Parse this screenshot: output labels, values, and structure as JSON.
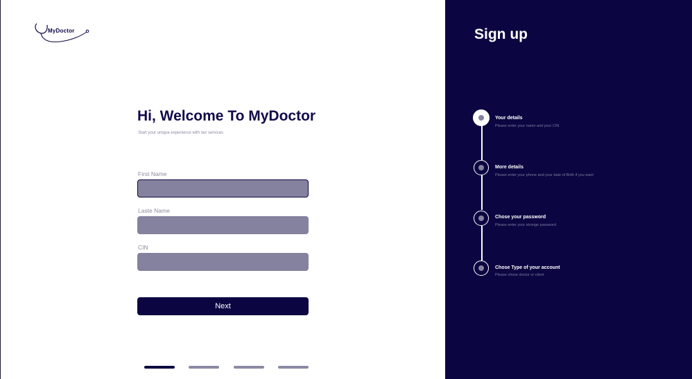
{
  "brand": {
    "name": "MyDoctor"
  },
  "form": {
    "title": "Hi, Welcome To MyDoctor",
    "subtitle": "Start your unique experience with our services",
    "fields": [
      {
        "label": "First Name",
        "value": ""
      },
      {
        "label": "Laste Name",
        "value": ""
      },
      {
        "label": "CIN",
        "value": ""
      }
    ],
    "next_label": "Next",
    "pagination": {
      "current": 1,
      "total": 4
    }
  },
  "sidebar": {
    "title": "Sign up",
    "steps": [
      {
        "title": "Your details",
        "desc": "Please  enter your name and your CIN",
        "active": true
      },
      {
        "title": "More details",
        "desc": "Please enter  your phone and your date of Birth if you want",
        "active": false
      },
      {
        "title": "Chose your password",
        "desc": "Please enter  your stronge password",
        "active": false
      },
      {
        "title": "Chose Type of your account",
        "desc": "Please chose doctor or client",
        "active": false
      }
    ]
  },
  "colors": {
    "primary": "#0b0641",
    "input_bg": "#84829e",
    "muted_text": "#8b8b9f"
  }
}
